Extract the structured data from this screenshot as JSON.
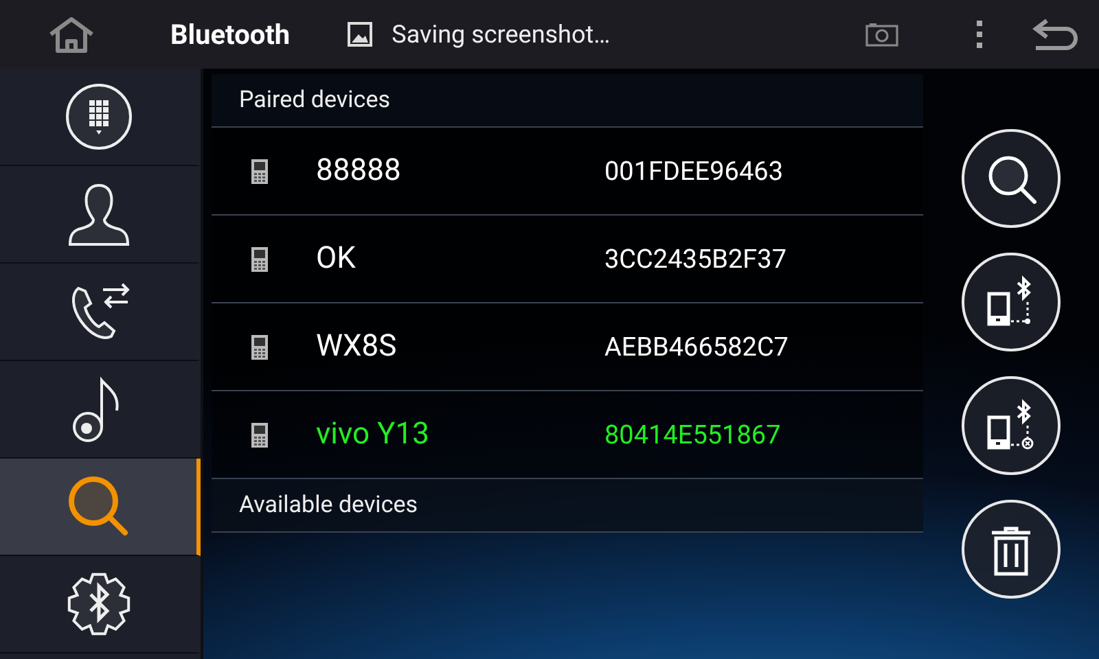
{
  "top_bar": {
    "title": "Bluetooth",
    "notification": "Saving screenshot…"
  },
  "sidebar": {
    "items": [
      {
        "kind": "dialpad",
        "selected": false
      },
      {
        "kind": "contacts",
        "selected": false
      },
      {
        "kind": "calls",
        "selected": false
      },
      {
        "kind": "music",
        "selected": false
      },
      {
        "kind": "search",
        "selected": true
      },
      {
        "kind": "settings",
        "selected": false
      }
    ]
  },
  "paired_header": "Paired devices",
  "paired_devices": [
    {
      "name": "88888",
      "address": "001FDEE96463",
      "connected": false
    },
    {
      "name": "OK",
      "address": "3CC2435B2F37",
      "connected": false
    },
    {
      "name": "WX8S",
      "address": "AEBB466582C7",
      "connected": false
    },
    {
      "name": "vivo Y13",
      "address": "80414E551867",
      "connected": true
    }
  ],
  "available_header": "Available devices",
  "actions": [
    {
      "kind": "search"
    },
    {
      "kind": "connect"
    },
    {
      "kind": "disconnect"
    },
    {
      "kind": "delete"
    }
  ]
}
